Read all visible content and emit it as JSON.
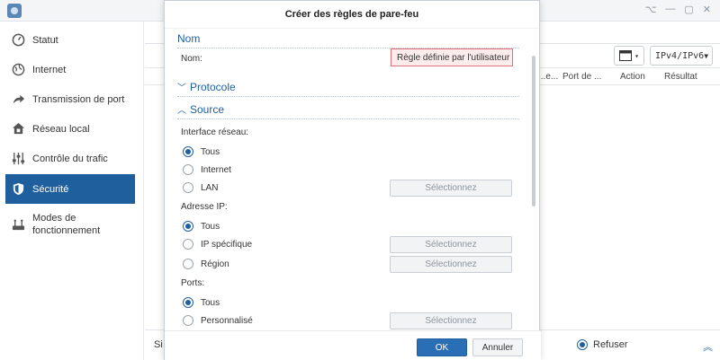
{
  "window": {
    "controls": [
      "⌥",
      "—",
      "▢",
      "✕"
    ]
  },
  "sidebar": {
    "items": [
      {
        "label": "Statut",
        "icon": "status-icon"
      },
      {
        "label": "Internet",
        "icon": "globe-icon"
      },
      {
        "label": "Transmission de port",
        "icon": "forward-arrow-icon"
      },
      {
        "label": "Réseau local",
        "icon": "home-network-icon"
      },
      {
        "label": "Contrôle du trafic",
        "icon": "sliders-icon"
      },
      {
        "label": "Sécurité",
        "icon": "shield-icon",
        "active": true
      },
      {
        "label": "Modes de fonctionnement",
        "icon": "router-icon"
      }
    ]
  },
  "main": {
    "ip_version": "IPv4/IPv6",
    "columns": [
      "...e...",
      "Port de ...",
      "Action",
      "Résultat"
    ],
    "bottom_partial": "Si",
    "refuse_label": "Refuser"
  },
  "dialog": {
    "title": "Créer des règles de pare-feu",
    "sections": {
      "nom": "Nom",
      "protocole": "Protocole",
      "source": "Source"
    },
    "name_label": "Nom:",
    "name_value": "Règle définie par l'utilisateur",
    "interface_label": "Interface réseau:",
    "interface_options": [
      "Tous",
      "Internet",
      "LAN"
    ],
    "ip_label": "Adresse IP:",
    "ip_options": [
      "Tous",
      "IP spécifique",
      "Région"
    ],
    "ports_label": "Ports:",
    "ports_options": [
      "Tous",
      "Personnalisé"
    ],
    "select_button": "Sélectionnez",
    "ok": "OK",
    "cancel": "Annuler"
  },
  "colors": {
    "accent": "#1f5f9e",
    "error_field": "#fdecec"
  }
}
